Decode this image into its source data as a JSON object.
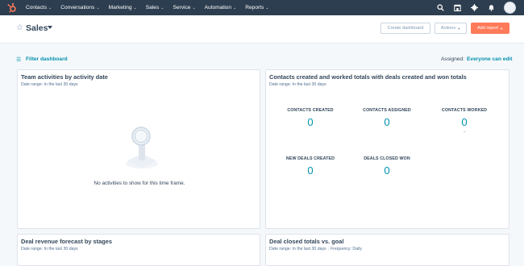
{
  "nav": {
    "items": [
      {
        "label": "Contacts"
      },
      {
        "label": "Conversations"
      },
      {
        "label": "Marketing"
      },
      {
        "label": "Sales"
      },
      {
        "label": "Service"
      },
      {
        "label": "Automation"
      },
      {
        "label": "Reports"
      }
    ],
    "right_icons": [
      "search-icon",
      "marketplace-icon",
      "settings-icon",
      "notifications-icon",
      "avatar"
    ]
  },
  "header": {
    "title": "Sales",
    "create_dashboard_label": "Create dashboard",
    "actions_label": "Actions",
    "add_report_label": "Add report"
  },
  "filters": {
    "filter_label": "Filter dashboard",
    "assigned_label": "Assigned:",
    "assigned_value": "Everyone can edit"
  },
  "cards": {
    "team_activities": {
      "title": "Team activities by activity date",
      "subtitle": "Date range: In the last 30 days",
      "empty_text": "No activities to show for this time frame."
    },
    "contacts_deals": {
      "title": "Contacts created and worked totals with deals created and won totals",
      "subtitle": "Date range: In the last 30 days",
      "metrics": [
        {
          "label": "CONTACTS CREATED",
          "value": "0"
        },
        {
          "label": "CONTACTS ASSIGNED",
          "value": "0"
        },
        {
          "label": "CONTACTS WORKED",
          "value": "0"
        },
        {
          "label": "NEW DEALS CREATED",
          "value": "0"
        },
        {
          "label": "DEALS CLOSED WON",
          "value": "0"
        }
      ]
    },
    "deal_revenue": {
      "title": "Deal revenue forecast by stages",
      "subtitle": "Date range: In the last 30 days"
    },
    "deal_closed": {
      "title": "Deal closed totals vs. goal",
      "subtitle_range": "Date range: In the last 30 days",
      "subtitle_frequency": "Frequency: Daily"
    }
  },
  "colors": {
    "nav_bg": "#2d3e50",
    "accent_orange": "#ff7a59",
    "link_teal": "#0091ae",
    "text_dark": "#33475b"
  }
}
